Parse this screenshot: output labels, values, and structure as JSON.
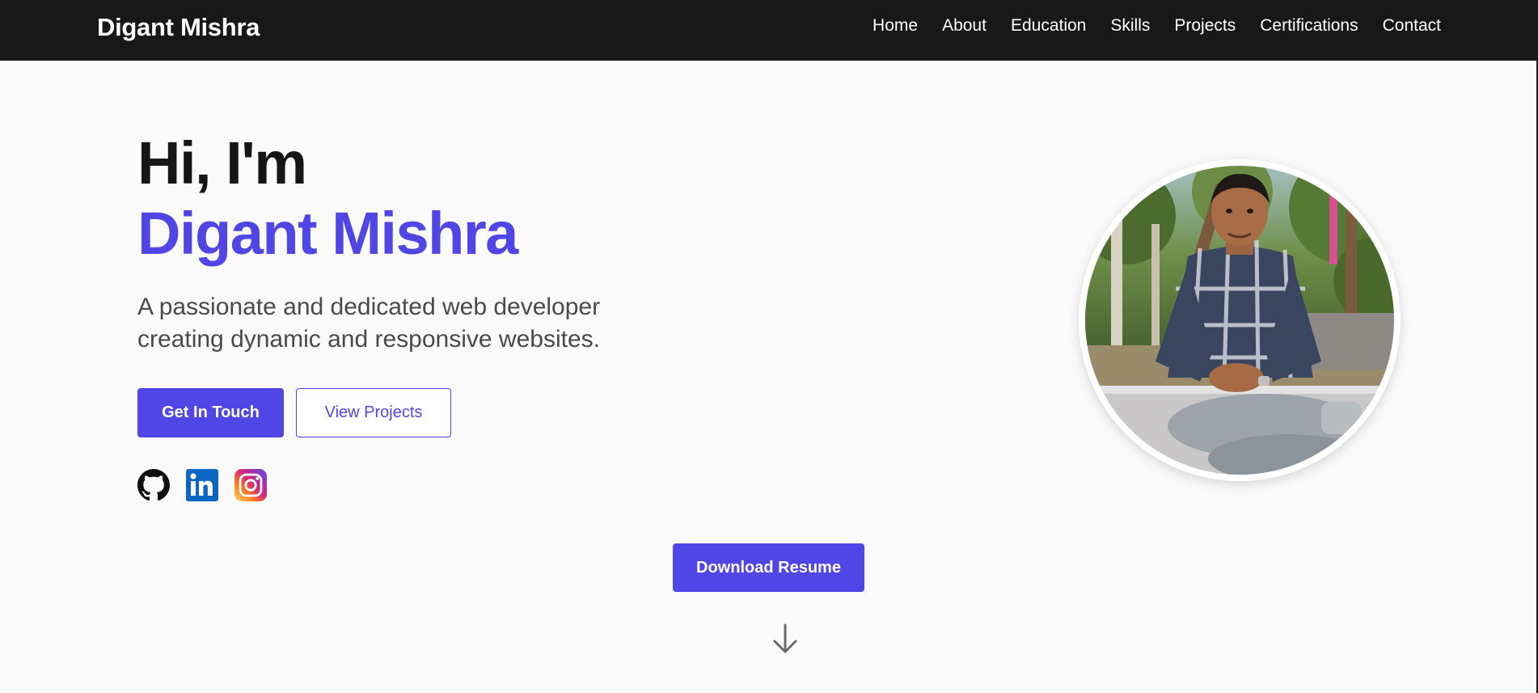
{
  "navbar": {
    "brand": "Digant Mishra",
    "links": [
      "Home",
      "About",
      "Education",
      "Skills",
      "Projects",
      "Certifications",
      "Contact"
    ]
  },
  "hero": {
    "greeting": "Hi, I'm",
    "name": "Digant Mishra",
    "tagline": "A passionate and dedicated web developer creating dynamic and responsive websites.",
    "primary_button": "Get In Touch",
    "secondary_button": "View Projects",
    "resume_button": "Download Resume"
  },
  "social": [
    {
      "icon": "github-icon",
      "color": "#111111"
    },
    {
      "icon": "linkedin-icon",
      "color": "#0a66c2"
    },
    {
      "icon": "instagram-icon",
      "color": "#d62976"
    }
  ],
  "profile": {
    "icon": "profile-photo"
  },
  "colors": {
    "accent": "#4f46e5",
    "nav_bg": "#181818",
    "page_bg": "#fafafa"
  }
}
